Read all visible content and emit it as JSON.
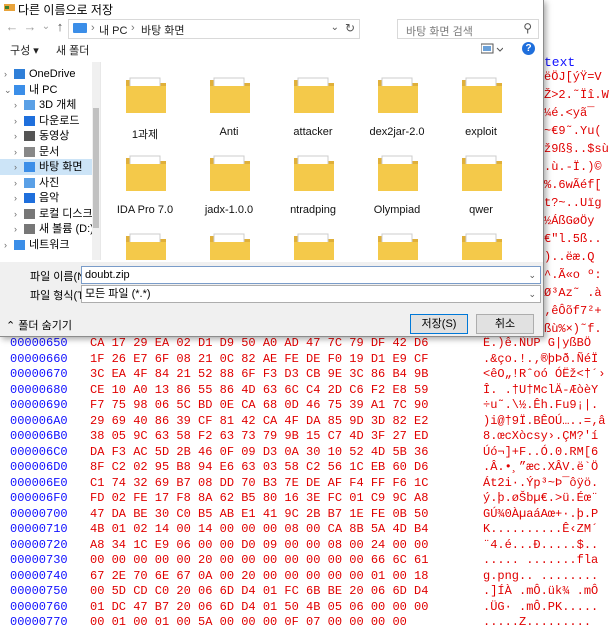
{
  "dialog": {
    "title": "다른 이름으로 저장",
    "nav": {
      "back": "←",
      "forward": "→",
      "recent": "⌄",
      "up": "↑",
      "path": [
        "내 PC",
        "바탕 화면"
      ],
      "search_placeholder": "바탕 화면 검색"
    },
    "toolbar": {
      "organize": "구성 ▾",
      "new_folder": "새 폴더",
      "help": "?"
    },
    "sidebar": [
      {
        "label": "OneDrive",
        "icon": "cloud-icon",
        "expand": "›"
      },
      {
        "label": "내 PC",
        "icon": "pc-icon",
        "expand": "⌄"
      },
      {
        "label": "3D 개체",
        "icon": "cube-icon",
        "expand": "›"
      },
      {
        "label": "다운로드",
        "icon": "download-icon",
        "expand": "›"
      },
      {
        "label": "동영상",
        "icon": "video-icon",
        "expand": "›"
      },
      {
        "label": "문서",
        "icon": "document-icon",
        "expand": "›"
      },
      {
        "label": "바탕 화면",
        "icon": "desktop-icon",
        "expand": "›",
        "selected": true
      },
      {
        "label": "사진",
        "icon": "picture-icon",
        "expand": "›"
      },
      {
        "label": "음악",
        "icon": "music-icon",
        "expand": "›"
      },
      {
        "label": "로컬 디스크 (C:)",
        "icon": "drive-icon",
        "expand": "›"
      },
      {
        "label": "새 볼륨 (D:)",
        "icon": "drive-icon",
        "expand": "›"
      },
      {
        "label": "네트워크",
        "icon": "network-icon",
        "expand": "›"
      }
    ],
    "files": [
      {
        "name": "1과제",
        "icon": "folder-icon"
      },
      {
        "name": "Anti",
        "icon": "folder-icon"
      },
      {
        "name": "attacker",
        "icon": "folder-icon"
      },
      {
        "name": "dex2jar-2.0",
        "icon": "folder-icon"
      },
      {
        "name": "exploit",
        "icon": "folder-icon"
      },
      {
        "name": "IDA Pro 7.0",
        "icon": "folder-icon"
      },
      {
        "name": "jadx-1.0.0",
        "icon": "folder-icon"
      },
      {
        "name": "ntradping",
        "icon": "folder-icon"
      },
      {
        "name": "Olympiad",
        "icon": "folder-icon"
      },
      {
        "name": "qwer",
        "icon": "folder-icon"
      },
      {
        "name": "",
        "icon": "folder-icon"
      },
      {
        "name": "",
        "icon": "folder-icon"
      },
      {
        "name": "",
        "icon": "folder-icon"
      },
      {
        "name": "",
        "icon": "folder-icon"
      },
      {
        "name": "",
        "icon": "folder-icon"
      }
    ],
    "form": {
      "filename_label": "파일 이름(N):",
      "filename_value": "doubt.zip",
      "filetype_label": "파일 형식(T):",
      "filetype_value": "모든 파일 (*.*)"
    },
    "footer": {
      "hide_folders": "폴더 숨기기",
      "save": "저장(S)",
      "cancel": "취소"
    }
  },
  "hex": {
    "title": "text",
    "right_lines": [
      "ëÖJ[ýŸ=V",
      "Ž>2.˜Ïî.W",
      "¼é.<yã¯",
      "~€9˜.Yu(",
      "ž9ß§..$sù",
      ".ù.-Ï.)©",
      "%.6wÃéf[",
      "t?~..Uïg",
      "½ÁßGøÖy",
      "€\"l.5ß..",
      ")..ëæ.Q",
      "^.Ã«o º:",
      "Ø³Az˜ .à",
      "‚êÔõf7²+",
      "ßù%×)˜f."
    ],
    "rows": [
      {
        "offset": "00000650",
        "bytes": "CA 17 29 EA 02 D1 D9 50 A0 AD 47 7C 79 DF 42 D6",
        "ascii": "Ê.)ê.ÑÙP ­G|yßBÖ"
      },
      {
        "offset": "00000660",
        "bytes": "1F 26 E7 6F 08 21 0C 82 AE FE DE F0 19 D1 E9 CF",
        "ascii": ".&ço.!.‚®þÞð.ÑéÏ"
      },
      {
        "offset": "00000670",
        "bytes": "3C EA 4F 84 21 52 88 6F F3 D3 CB 9E 3C 86 B4 9B",
        "ascii": "<êO„!Rˆoó ÓËž<†´›"
      },
      {
        "offset": "00000680",
        "bytes": "CE 10 A0 13 86 55 86 4D 63 6C C4 2D C6 F2 E8 59",
        "ascii": "Î. .†U†MclÄ-ÆòèY"
      },
      {
        "offset": "00000690",
        "bytes": "F7 75 98 06 5C BD 0E CA 68 0D 46 75 39 A1 7C 90",
        "ascii": "÷u˜.\\½.Êh.Fu9¡|."
      },
      {
        "offset": "000006A0",
        "bytes": "29 69 40 86 39 CF 81 42 CA 4F DA 85 9D 3D 82 E2",
        "ascii": ")i@†9Ï.BÊOÚ…..=‚â"
      },
      {
        "offset": "000006B0",
        "bytes": "38 05 9C 63 58 F2 63 73 79 9B 15 C7 4D 3F 27 ED",
        "ascii": "8.œcXòcsy›.ÇM?'í"
      },
      {
        "offset": "000006C0",
        "bytes": "DA F3 AC 5D 2B 46 0F 09 D3 0A 30 10 52 4D 5B 36",
        "ascii": "Úó¬]+F..Ó.0.RM[6"
      },
      {
        "offset": "000006D0",
        "bytes": "8F C2 02 95 B8 94 E6 63 03 58 C2 56 1C EB 60 D6",
        "ascii": ".Â.•¸”æc.XÂV.ë`Ö"
      },
      {
        "offset": "000006E0",
        "bytes": "C1 74 32 69 B7 08 DD 70 B3 7E DE AF F4 FF F6 1C",
        "ascii": "Át2i·.Ýp³~Þ¯ôÿö."
      },
      {
        "offset": "000006F0",
        "bytes": "FD 02 FE 17 F8 8A 62 B5 80 16 3E FC 01 C9 9C A8",
        "ascii": "ý.þ.øŠbµ€.>ü.Éœ¨"
      },
      {
        "offset": "00000700",
        "bytes": "47 DA BE 30 C0 B5 AB E1 41 9C 2B B7 1E FE 0B 50",
        "ascii": "GÚ¾0ÀµaáAœ+·.þ.P"
      },
      {
        "offset": "00000710",
        "bytes": "4B 01 02 14 00 14 00 00 00 08 00 CA 8B 5A 4D B4",
        "ascii": "K..........Ê‹ZM´"
      },
      {
        "offset": "00000720",
        "bytes": "A8 34 1C E9 06 00 00 D0 09 00 00 08 00 24 00 00",
        "ascii": "¨4.é...Ð.....$.."
      },
      {
        "offset": "00000730",
        "bytes": "00 00 00 00 00 20 00 00 00 00 00 00 00 66 6C 61",
        "ascii": "..... .......fla"
      },
      {
        "offset": "00000740",
        "bytes": "67 2E 70 6E 67 0A 00 20 00 00 00 00 00 01 00 18",
        "ascii": "g.png.. ........"
      },
      {
        "offset": "00000750",
        "bytes": "00 5D CD C0 20 06 6D D4 01 FC 6B BE 20 06 6D D4",
        "ascii": ".]ÍÀ .mÔ.ük¾ .mÔ"
      },
      {
        "offset": "00000760",
        "bytes": "01 DC 47 B7 20 06 6D D4 01 50 4B 05 06 00 00 00",
        "ascii": ".ÜG· .mÔ.PK....."
      },
      {
        "offset": "00000770",
        "bytes": "00 01 00 01 00 5A 00 00 00 0F 07 00 00 00 00",
        "ascii": ".....Z........."
      }
    ]
  },
  "colors": {
    "offset": "#1010ff",
    "hex_text": "#e00000",
    "folder": "#f4c94a",
    "accent": "#0078d7",
    "selection": "#cce4f7"
  }
}
